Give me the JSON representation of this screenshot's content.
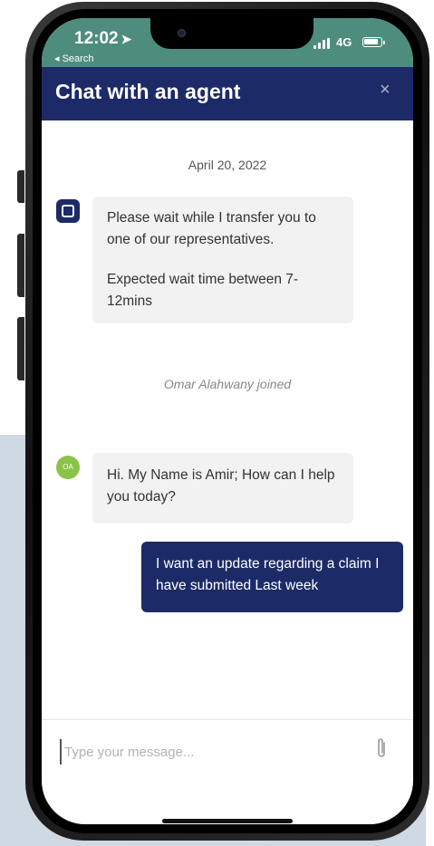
{
  "status_bar": {
    "time": "12:02",
    "back_label": "◂ Search",
    "network": "4G"
  },
  "header": {
    "title": "Chat with an agent",
    "close_label": "×"
  },
  "chat": {
    "date": "April 20, 2022",
    "messages": [
      {
        "paragraphs": [
          "Please wait while I transfer you to one of our representatives.",
          "Expected wait time between 7-12mins"
        ]
      },
      {
        "text": "Hi. My Name is Amir; How can I help you today?"
      },
      {
        "text": "I want an update regarding a claim I have submitted Last week"
      }
    ],
    "joined_notice": "Omar Alahwany joined",
    "agent_avatar_initials": "OA"
  },
  "composer": {
    "placeholder": "Type your message..."
  },
  "colors": {
    "status_bar": "#4e8d7d",
    "brand_navy": "#1c2b67",
    "avatar_green": "#8bc34a",
    "incoming_bubble": "#f2f2f3",
    "background_panel": "#cfd9e3"
  },
  "icons": [
    "location-arrow-icon",
    "signal-icon",
    "battery-icon",
    "close-icon",
    "bot-icon",
    "paperclip-icon"
  ]
}
